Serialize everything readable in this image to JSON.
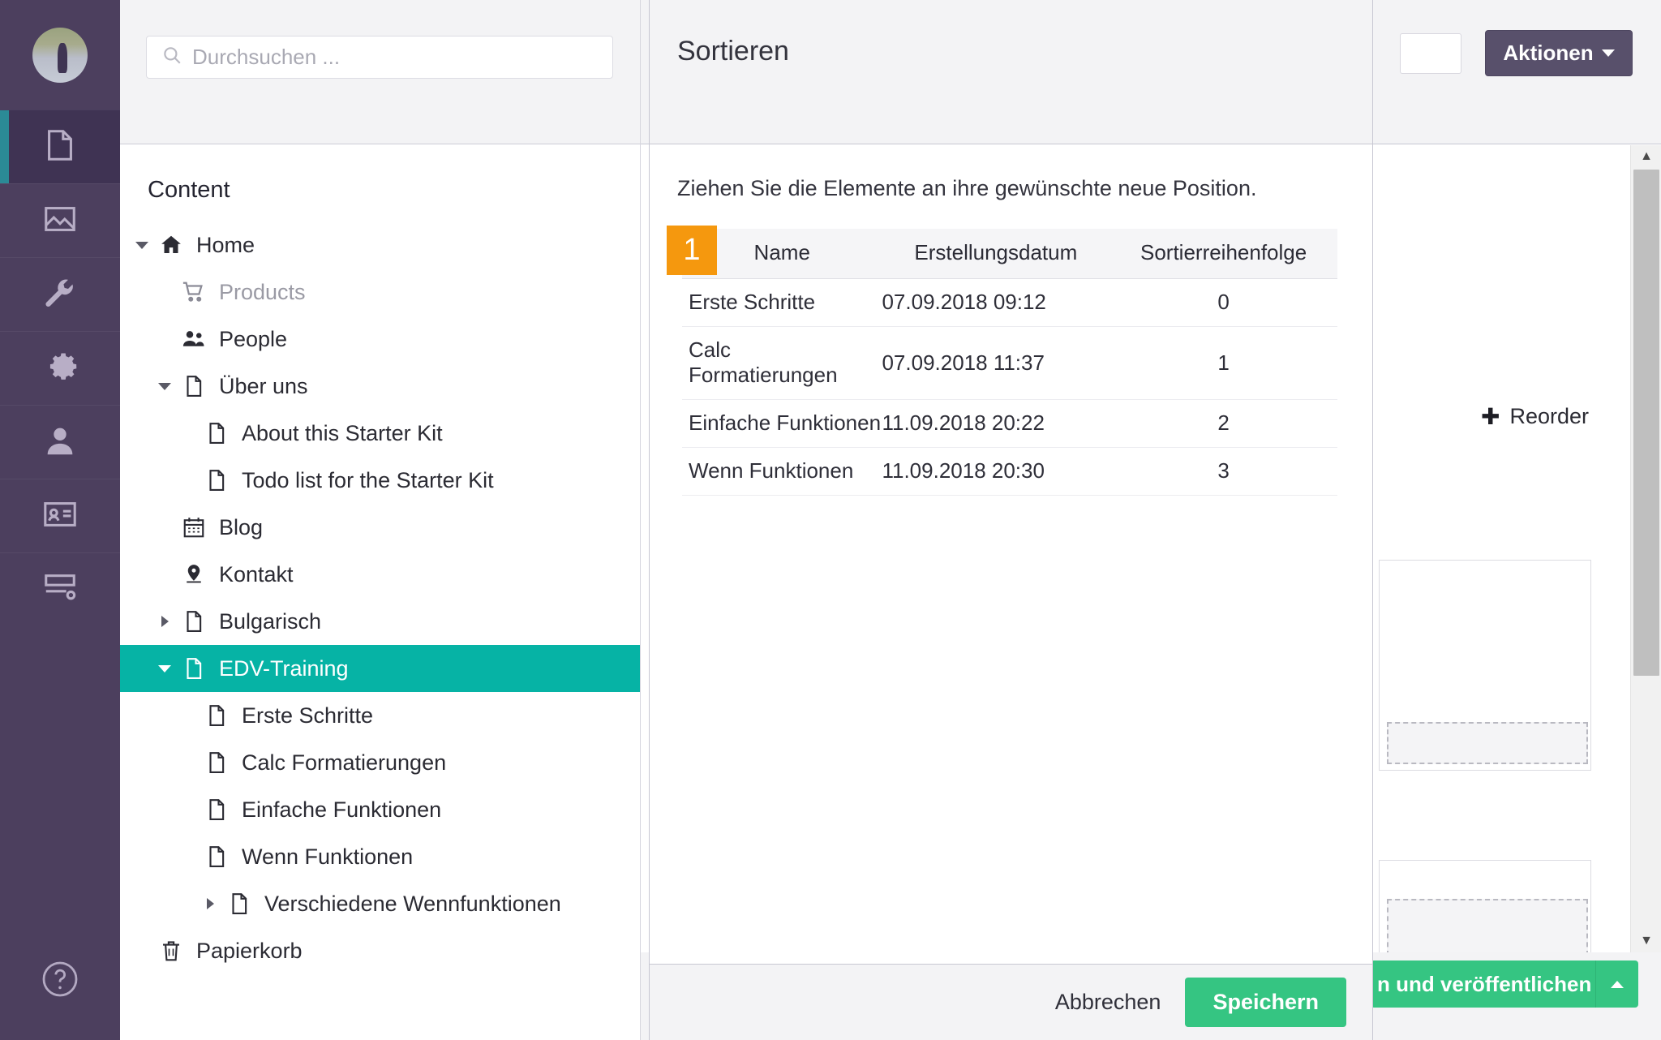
{
  "rail": {
    "avatar_name": "user-avatar",
    "items": [
      {
        "icon": "content-document-icon",
        "name": "rail-item-content",
        "active": true
      },
      {
        "icon": "media-image-icon",
        "name": "rail-item-media",
        "active": false
      },
      {
        "icon": "wrench-settings-icon",
        "name": "rail-item-settings",
        "active": false
      },
      {
        "icon": "gear-icon",
        "name": "rail-item-developer",
        "active": false
      },
      {
        "icon": "user-icon",
        "name": "rail-item-users",
        "active": false
      },
      {
        "icon": "member-card-icon",
        "name": "rail-item-members",
        "active": false
      },
      {
        "icon": "forms-icon",
        "name": "rail-item-forms",
        "active": false
      }
    ],
    "help_icon": "help-question-icon"
  },
  "search": {
    "placeholder": "Durchsuchen ...",
    "value": "",
    "icon": "search-icon"
  },
  "tree": {
    "title": "Content",
    "nodes": [
      {
        "label": "Home",
        "indent": 0,
        "icon": "home-icon",
        "twisty": "open",
        "dim": false,
        "selected": false
      },
      {
        "label": "Products",
        "indent": 1,
        "icon": "cart-icon",
        "twisty": "none",
        "dim": true,
        "selected": false
      },
      {
        "label": "People",
        "indent": 1,
        "icon": "people-icon",
        "twisty": "none",
        "dim": false,
        "selected": false
      },
      {
        "label": "Über uns",
        "indent": 1,
        "icon": "doc-icon",
        "twisty": "open",
        "dim": false,
        "selected": false
      },
      {
        "label": "About this Starter Kit",
        "indent": 2,
        "icon": "doc-icon",
        "twisty": "none",
        "dim": false,
        "selected": false
      },
      {
        "label": "Todo list for the Starter Kit",
        "indent": 2,
        "icon": "doc-icon",
        "twisty": "none",
        "dim": false,
        "selected": false
      },
      {
        "label": "Blog",
        "indent": 1,
        "icon": "calendar-icon",
        "twisty": "none",
        "dim": false,
        "selected": false
      },
      {
        "label": "Kontakt",
        "indent": 1,
        "icon": "map-pin-icon",
        "twisty": "none",
        "dim": false,
        "selected": false
      },
      {
        "label": "Bulgarisch",
        "indent": 1,
        "icon": "doc-icon",
        "twisty": "closed",
        "dim": false,
        "selected": false
      },
      {
        "label": "EDV-Training",
        "indent": 1,
        "icon": "doc-icon",
        "twisty": "open",
        "dim": false,
        "selected": true
      },
      {
        "label": "Erste Schritte",
        "indent": 2,
        "icon": "doc-icon",
        "twisty": "none",
        "dim": false,
        "selected": false
      },
      {
        "label": "Calc Formatierungen",
        "indent": 2,
        "icon": "doc-icon",
        "twisty": "none",
        "dim": false,
        "selected": false
      },
      {
        "label": "Einfache Funktionen",
        "indent": 2,
        "icon": "doc-icon",
        "twisty": "none",
        "dim": false,
        "selected": false
      },
      {
        "label": "Wenn Funktionen",
        "indent": 2,
        "icon": "doc-icon",
        "twisty": "none",
        "dim": false,
        "selected": false
      },
      {
        "label": "Verschiedene Wennfunktionen",
        "indent": 3,
        "icon": "doc-icon",
        "twisty": "closed",
        "dim": false,
        "selected": false
      },
      {
        "label": "Papierkorb",
        "indent": 0,
        "icon": "trash-icon",
        "twisty": "none",
        "dim": false,
        "selected": false
      }
    ]
  },
  "dialog": {
    "title": "Sortieren",
    "hint": "Ziehen Sie die Elemente an ihre gewünschte neue Position.",
    "badge": "1",
    "badge_color": "#f5980e",
    "columns": [
      "Name",
      "Erstellungsdatum",
      "Sortierreihenfolge"
    ],
    "rows": [
      {
        "name": "Erste Schritte",
        "created": "07.09.2018 09:12",
        "order": "0"
      },
      {
        "name": "Calc Formatierungen",
        "created": "07.09.2018 11:37",
        "order": "1"
      },
      {
        "name": "Einfache Funktionen",
        "created": "11.09.2018 20:22",
        "order": "2"
      },
      {
        "name": "Wenn Funktionen",
        "created": "11.09.2018 20:30",
        "order": "3"
      }
    ],
    "cancel_label": "Abbrechen",
    "save_label": "Speichern"
  },
  "background": {
    "actions_label": "Aktionen",
    "reorder_label": "Reorder",
    "reorder_icon": "move-cross-icon",
    "publish_label": "n und veröffentlichen",
    "name_field_value": ""
  },
  "colors": {
    "rail": "#4c3f5e",
    "accent_teal": "#06b3a5",
    "accent_green": "#35c582",
    "accent_orange": "#f5980e",
    "actions_purple": "#58506b"
  }
}
